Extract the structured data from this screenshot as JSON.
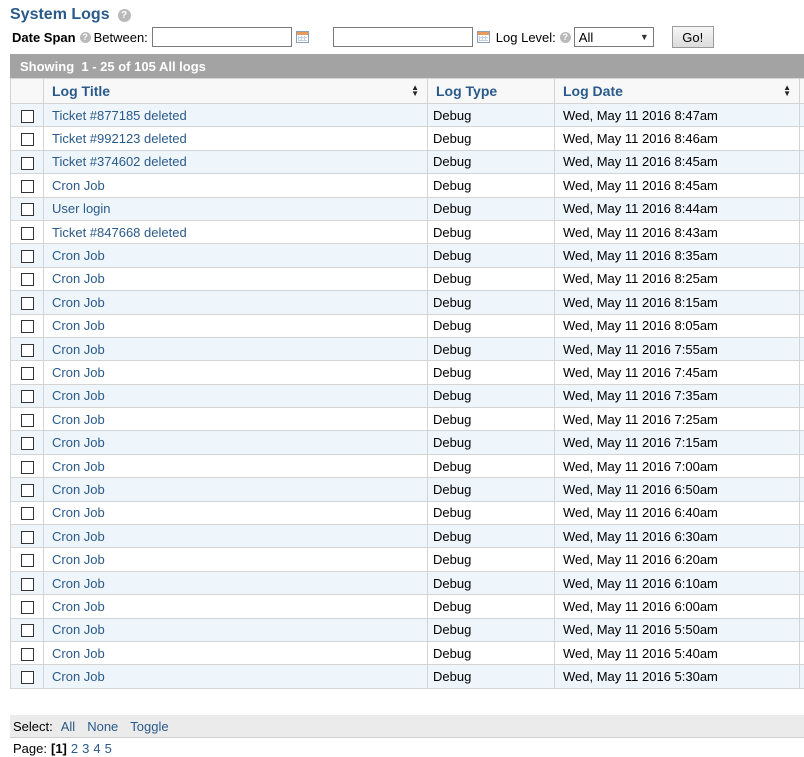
{
  "header": {
    "title": "System Logs"
  },
  "filters": {
    "date_span_label": "Date Span",
    "between_label": "Between:",
    "start_value": "",
    "end_value": "",
    "log_level_label": "Log Level:",
    "log_level_value": "All",
    "go_label": "Go!"
  },
  "summary": {
    "showing_text": "Showing  1 - 25 of 105 All logs"
  },
  "table": {
    "columns": [
      "Log Title",
      "Log Type",
      "Log Date"
    ],
    "rows": [
      {
        "title": "Ticket #877185 deleted",
        "type": "Debug",
        "date": "Wed, May 11 2016 8:47am"
      },
      {
        "title": "Ticket #992123 deleted",
        "type": "Debug",
        "date": "Wed, May 11 2016 8:46am"
      },
      {
        "title": "Ticket #374602 deleted",
        "type": "Debug",
        "date": "Wed, May 11 2016 8:45am"
      },
      {
        "title": "Cron Job",
        "type": "Debug",
        "date": "Wed, May 11 2016 8:45am"
      },
      {
        "title": "User login",
        "type": "Debug",
        "date": "Wed, May 11 2016 8:44am"
      },
      {
        "title": "Ticket #847668 deleted",
        "type": "Debug",
        "date": "Wed, May 11 2016 8:43am"
      },
      {
        "title": "Cron Job",
        "type": "Debug",
        "date": "Wed, May 11 2016 8:35am"
      },
      {
        "title": "Cron Job",
        "type": "Debug",
        "date": "Wed, May 11 2016 8:25am"
      },
      {
        "title": "Cron Job",
        "type": "Debug",
        "date": "Wed, May 11 2016 8:15am"
      },
      {
        "title": "Cron Job",
        "type": "Debug",
        "date": "Wed, May 11 2016 8:05am"
      },
      {
        "title": "Cron Job",
        "type": "Debug",
        "date": "Wed, May 11 2016 7:55am"
      },
      {
        "title": "Cron Job",
        "type": "Debug",
        "date": "Wed, May 11 2016 7:45am"
      },
      {
        "title": "Cron Job",
        "type": "Debug",
        "date": "Wed, May 11 2016 7:35am"
      },
      {
        "title": "Cron Job",
        "type": "Debug",
        "date": "Wed, May 11 2016 7:25am"
      },
      {
        "title": "Cron Job",
        "type": "Debug",
        "date": "Wed, May 11 2016 7:15am"
      },
      {
        "title": "Cron Job",
        "type": "Debug",
        "date": "Wed, May 11 2016 7:00am"
      },
      {
        "title": "Cron Job",
        "type": "Debug",
        "date": "Wed, May 11 2016 6:50am"
      },
      {
        "title": "Cron Job",
        "type": "Debug",
        "date": "Wed, May 11 2016 6:40am"
      },
      {
        "title": "Cron Job",
        "type": "Debug",
        "date": "Wed, May 11 2016 6:30am"
      },
      {
        "title": "Cron Job",
        "type": "Debug",
        "date": "Wed, May 11 2016 6:20am"
      },
      {
        "title": "Cron Job",
        "type": "Debug",
        "date": "Wed, May 11 2016 6:10am"
      },
      {
        "title": "Cron Job",
        "type": "Debug",
        "date": "Wed, May 11 2016 6:00am"
      },
      {
        "title": "Cron Job",
        "type": "Debug",
        "date": "Wed, May 11 2016 5:50am"
      },
      {
        "title": "Cron Job",
        "type": "Debug",
        "date": "Wed, May 11 2016 5:40am"
      },
      {
        "title": "Cron Job",
        "type": "Debug",
        "date": "Wed, May 11 2016 5:30am"
      }
    ]
  },
  "selection": {
    "label": "Select:",
    "all": "All",
    "none": "None",
    "toggle": "Toggle"
  },
  "pager": {
    "label": "Page:",
    "current": "[1]",
    "pages": [
      "2",
      "3",
      "4",
      "5"
    ]
  },
  "icons": {
    "help": "help-icon",
    "calendar": "calendar-icon",
    "sort": "sort-icon",
    "dropdown": "chevron-down-icon"
  }
}
